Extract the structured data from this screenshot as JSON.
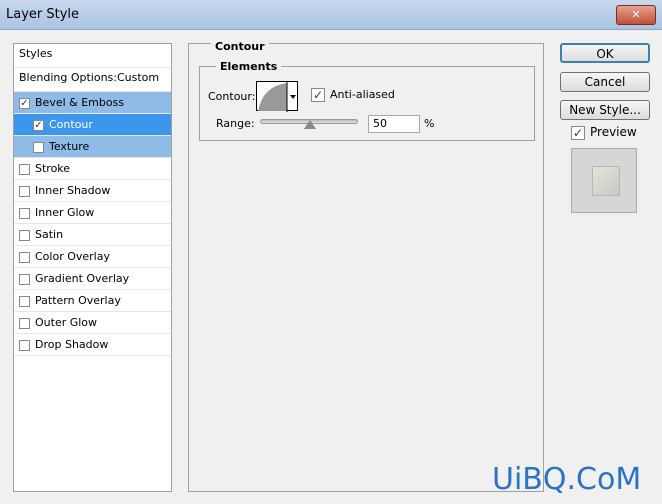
{
  "window": {
    "title": "Layer Style",
    "close_icon": "close-icon"
  },
  "styles": {
    "header": "Styles",
    "blending": "Blending Options:Custom",
    "items": [
      {
        "label": "Bevel & Emboss",
        "checked": true
      },
      {
        "label": "Contour",
        "checked": true
      },
      {
        "label": "Texture",
        "checked": false
      },
      {
        "label": "Stroke",
        "checked": false
      },
      {
        "label": "Inner Shadow",
        "checked": false
      },
      {
        "label": "Inner Glow",
        "checked": false
      },
      {
        "label": "Satin",
        "checked": false
      },
      {
        "label": "Color Overlay",
        "checked": false
      },
      {
        "label": "Gradient Overlay",
        "checked": false
      },
      {
        "label": "Pattern Overlay",
        "checked": false
      },
      {
        "label": "Outer Glow",
        "checked": false
      },
      {
        "label": "Drop Shadow",
        "checked": false
      }
    ]
  },
  "panel": {
    "title": "Contour",
    "group": "Elements",
    "contour_label": "Contour:",
    "anti_aliased": "Anti-aliased",
    "anti_aliased_checked": true,
    "range_label": "Range:",
    "range_value": "50",
    "range_unit": "%",
    "range_percent": 50
  },
  "buttons": {
    "ok": "OK",
    "cancel": "Cancel",
    "new_style": "New Style...",
    "preview": "Preview",
    "preview_checked": true
  },
  "watermark": "UiBQ.CoM"
}
